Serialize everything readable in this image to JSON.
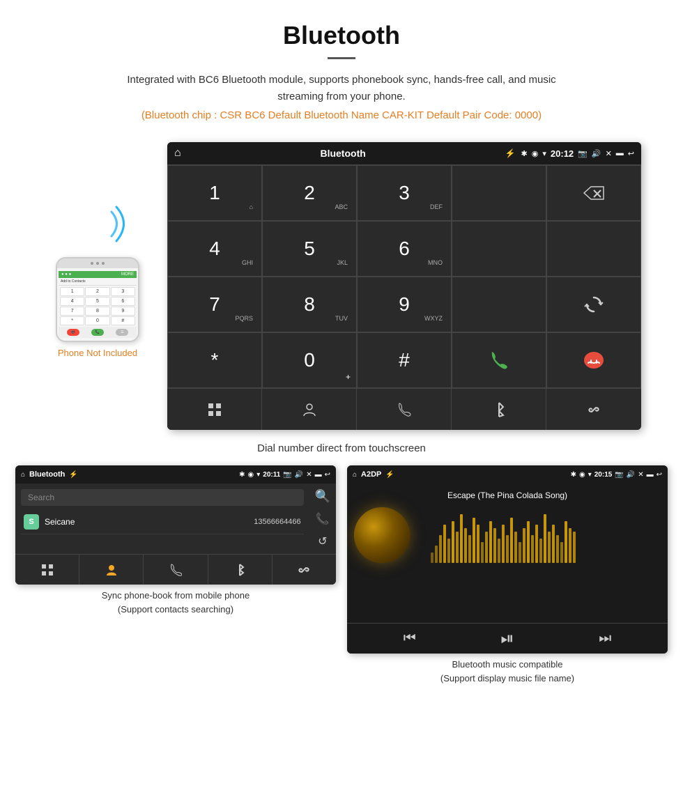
{
  "header": {
    "title": "Bluetooth",
    "description": "Integrated with BC6 Bluetooth module, supports phonebook sync, hands-free call, and music streaming from your phone.",
    "specs": "(Bluetooth chip : CSR BC6   Default Bluetooth Name CAR-KIT    Default Pair Code: 0000)"
  },
  "phone_illustration": {
    "not_included_label": "Phone Not Included",
    "contact_label": "Add to Contacts",
    "keypad_keys": [
      "1",
      "2",
      "3",
      "4",
      "5",
      "6",
      "7",
      "8",
      "9",
      "*",
      "0",
      "#"
    ]
  },
  "dial_screen": {
    "title": "Bluetooth",
    "time": "20:12",
    "keys": [
      {
        "num": "1",
        "sub": "⌂"
      },
      {
        "num": "2",
        "sub": "ABC"
      },
      {
        "num": "3",
        "sub": "DEF"
      },
      {
        "num": "",
        "sub": ""
      },
      {
        "action": "backspace"
      },
      {
        "num": "4",
        "sub": "GHI"
      },
      {
        "num": "5",
        "sub": "JKL"
      },
      {
        "num": "6",
        "sub": "MNO"
      },
      {
        "num": "",
        "sub": ""
      },
      {
        "num": "",
        "sub": ""
      },
      {
        "num": "7",
        "sub": "PQRS"
      },
      {
        "num": "8",
        "sub": "TUV"
      },
      {
        "num": "9",
        "sub": "WXYZ"
      },
      {
        "num": "",
        "sub": ""
      },
      {
        "action": "sync"
      },
      {
        "num": "*",
        "sub": ""
      },
      {
        "num": "0",
        "sub": "+"
      },
      {
        "num": "#",
        "sub": ""
      },
      {
        "action": "call"
      },
      {
        "action": "end-call"
      }
    ],
    "bottom_nav": [
      "grid",
      "person",
      "phone",
      "bluetooth",
      "link"
    ]
  },
  "dial_caption": "Dial number direct from touchscreen",
  "phonebook_screen": {
    "title": "Bluetooth",
    "time": "20:11",
    "search_placeholder": "Search",
    "contact_name": "Seicane",
    "contact_initial": "S",
    "contact_number": "13566664466"
  },
  "music_screen": {
    "title": "A2DP",
    "time": "20:15",
    "song_title": "Escape (The Pina Colada Song)"
  },
  "bottom_captions": {
    "phonebook": "Sync phone-book from mobile phone\n(Support contacts searching)",
    "music": "Bluetooth music compatible\n(Support display music file name)"
  },
  "colors": {
    "accent_orange": "#e67e22",
    "android_dark": "#2a2a2a",
    "android_darker": "#1a1a1a",
    "call_green": "#4caf50",
    "call_red": "#e74c3c",
    "gold": "#f5a623"
  },
  "viz_bars": [
    15,
    25,
    40,
    55,
    35,
    60,
    45,
    70,
    50,
    40,
    65,
    55,
    30,
    45,
    60,
    50,
    35,
    55,
    40,
    65,
    45,
    30,
    50,
    60,
    40,
    55,
    35,
    70,
    45,
    55,
    40,
    30,
    60,
    50,
    45
  ]
}
